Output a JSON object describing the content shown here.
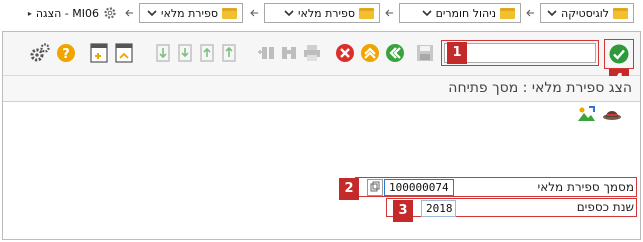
{
  "breadcrumb": {
    "items": [
      "לוגיסטיקה",
      "ניהול חומרים",
      "ספירת מלאי",
      "ספירת מלאי"
    ],
    "current": "MI06 - הצגה"
  },
  "toolbar": {
    "command_value": "",
    "markers": {
      "command": "1",
      "enter": "4"
    }
  },
  "screen": {
    "title": "הצג ספירת מלאי : מסך פתיחה"
  },
  "form": {
    "doc_label": "מסמך ספירת מלאי",
    "doc_value": "100000074",
    "doc_marker": "2",
    "year_label": "שנת כספים",
    "year_value": "2018",
    "year_marker": "3"
  },
  "colors": {
    "marker": "#c42a2a",
    "enter_green": "#2e9a3a",
    "cancel_red": "#d9302c",
    "nav_yellow": "#f0a400",
    "nav_green": "#3aa33e",
    "folder": "#f2bf2f"
  }
}
